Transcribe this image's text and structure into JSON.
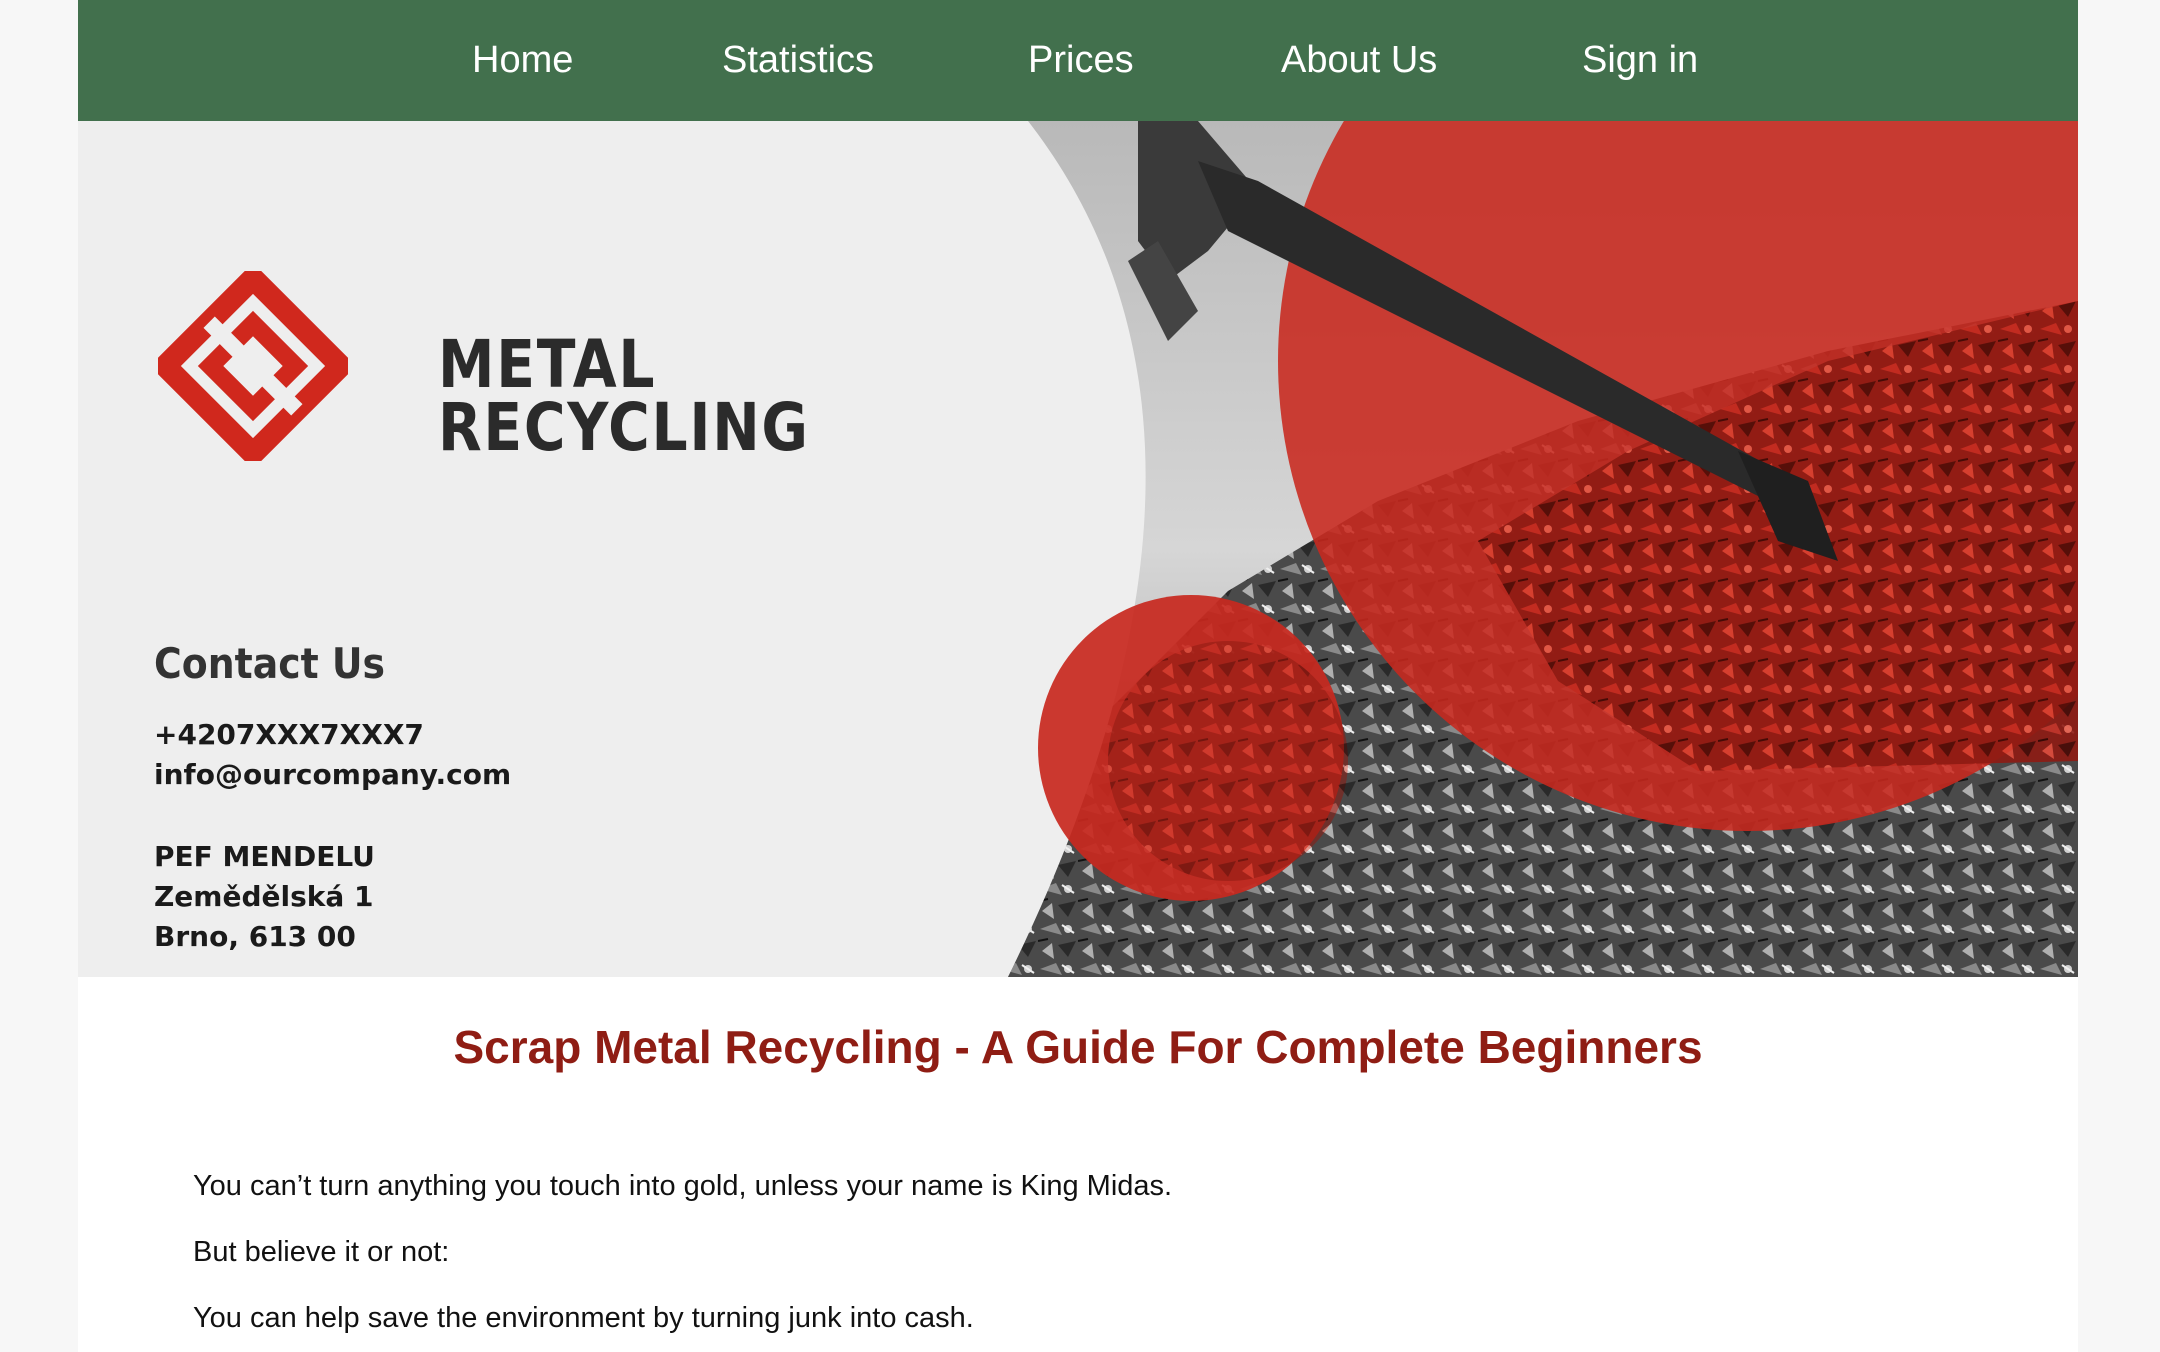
{
  "nav": {
    "items": [
      {
        "label": "Home"
      },
      {
        "label": "Statistics"
      },
      {
        "label": "Prices"
      },
      {
        "label": "About Us"
      },
      {
        "label": "Sign in"
      }
    ]
  },
  "hero": {
    "logo": {
      "line1": "METAL",
      "line2": "RECYCLING",
      "icon": "recycling-diamond-logo"
    },
    "contact": {
      "title": "Contact Us",
      "phone": "+4207XXX7XXX7",
      "email": "info@ourcompany.com",
      "address_line1": "PEF MENDELU",
      "address_line2": "Zemědělská 1",
      "address_line3": "Brno, 613 00"
    },
    "image": "excavator-scrap-metal-photo"
  },
  "article": {
    "title": "Scrap Metal Recycling - A Guide For Complete Beginners",
    "paragraphs": [
      "You can’t turn anything you touch into gold, unless your name is King Midas.",
      "But believe it or not:",
      "You can help save the environment by turning junk into cash."
    ]
  },
  "colors": {
    "nav_bg": "#42704d",
    "accent_red": "#c8281e",
    "title_red": "#8f1d14",
    "hero_bg": "#eeeeee"
  }
}
